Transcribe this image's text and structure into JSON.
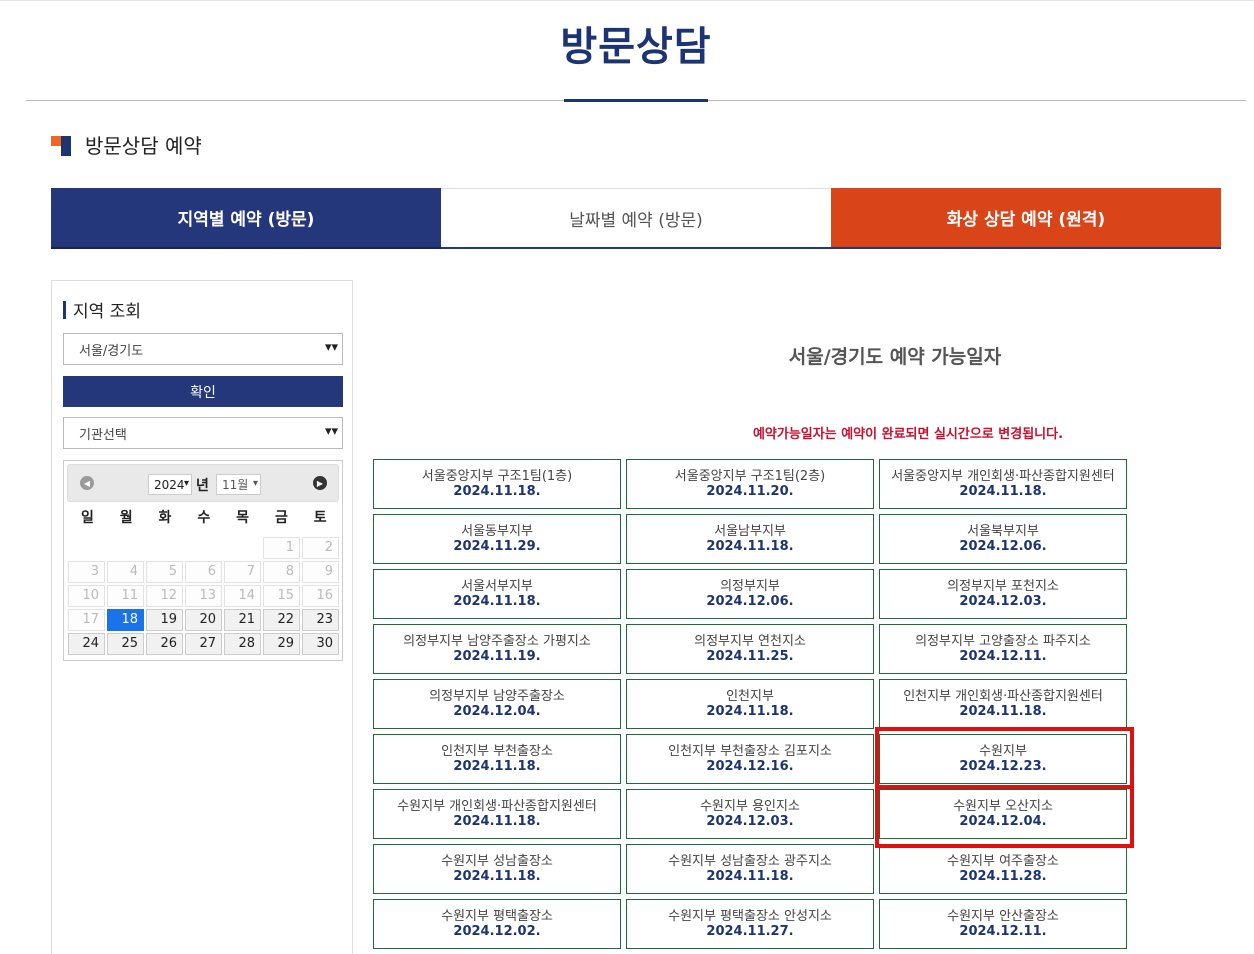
{
  "header": {
    "title": "방문상담"
  },
  "section": {
    "title": "방문상담 예약"
  },
  "tabs": [
    {
      "label": "지역별 예약 (방문)"
    },
    {
      "label": "날짜별 예약 (방문)"
    },
    {
      "label": "화상 상담 예약 (원격)"
    }
  ],
  "sidebar": {
    "title": "지역 조회",
    "region_select": "서울/경기도",
    "confirm_label": "확인",
    "org_select": "기관선택",
    "calendar": {
      "year": "2024",
      "year_suffix": "년",
      "month": "11월",
      "weekdays": [
        "일",
        "월",
        "화",
        "수",
        "목",
        "금",
        "토"
      ],
      "weeks": [
        [
          "",
          "",
          "",
          "",
          "",
          "1",
          "2"
        ],
        [
          "3",
          "4",
          "5",
          "6",
          "7",
          "8",
          "9"
        ],
        [
          "10",
          "11",
          "12",
          "13",
          "14",
          "15",
          "16"
        ],
        [
          "17",
          "18",
          "19",
          "20",
          "21",
          "22",
          "23"
        ],
        [
          "24",
          "25",
          "26",
          "27",
          "28",
          "29",
          "30"
        ]
      ],
      "today": "18"
    }
  },
  "main": {
    "title": "서울/경기도 예약 가능일자",
    "notice": "예약가능일자는 예약이 완료되면 실시간으로 변경됩니다.",
    "branches": [
      {
        "name": "서울중앙지부 구조1팀(1층)",
        "date": "2024.11.18."
      },
      {
        "name": "서울중앙지부 구조1팀(2층)",
        "date": "2024.11.20."
      },
      {
        "name": "서울중앙지부 개인회생·파산종합지원센터",
        "date": "2024.11.18."
      },
      {
        "name": "서울동부지부",
        "date": "2024.11.29."
      },
      {
        "name": "서울남부지부",
        "date": "2024.11.18."
      },
      {
        "name": "서울북부지부",
        "date": "2024.12.06."
      },
      {
        "name": "서울서부지부",
        "date": "2024.11.18."
      },
      {
        "name": "의정부지부",
        "date": "2024.12.06."
      },
      {
        "name": "의정부지부 포천지소",
        "date": "2024.12.03."
      },
      {
        "name": "의정부지부 남양주출장소 가평지소",
        "date": "2024.11.19."
      },
      {
        "name": "의정부지부 연천지소",
        "date": "2024.11.25."
      },
      {
        "name": "의정부지부 고양출장소 파주지소",
        "date": "2024.12.11."
      },
      {
        "name": "의정부지부 남양주출장소",
        "date": "2024.12.04."
      },
      {
        "name": "인천지부",
        "date": "2024.11.18."
      },
      {
        "name": "인천지부 개인회생·파산종합지원센터",
        "date": "2024.11.18."
      },
      {
        "name": "인천지부 부천출장소",
        "date": "2024.11.18."
      },
      {
        "name": "인천지부 부천출장소 김포지소",
        "date": "2024.12.16."
      },
      {
        "name": "수원지부",
        "date": "2024.12.23."
      },
      {
        "name": "수원지부 개인회생·파산종합지원센터",
        "date": "2024.11.18."
      },
      {
        "name": "수원지부 용인지소",
        "date": "2024.12.03."
      },
      {
        "name": "수원지부 오산지소",
        "date": "2024.12.04."
      },
      {
        "name": "수원지부 성남출장소",
        "date": "2024.11.18."
      },
      {
        "name": "수원지부 성남출장소 광주지소",
        "date": "2024.11.18."
      },
      {
        "name": "수원지부 여주출장소",
        "date": "2024.11.28."
      },
      {
        "name": "수원지부 평택출장소",
        "date": "2024.12.02."
      },
      {
        "name": "수원지부 평택출장소 안성지소",
        "date": "2024.11.27."
      },
      {
        "name": "수원지부 안산출장소",
        "date": "2024.12.11."
      }
    ]
  },
  "icons": {
    "select_chevron": "chevron-down-icon",
    "prev_month": "arrow-left-icon",
    "next_month": "arrow-right-icon"
  },
  "colors": {
    "brand_navy": "#24377a",
    "accent_orange": "#d94418",
    "notice_red": "#c8102e",
    "highlight": "#e01010",
    "card_border": "#1d6b3c",
    "today": "#1a73e8"
  }
}
